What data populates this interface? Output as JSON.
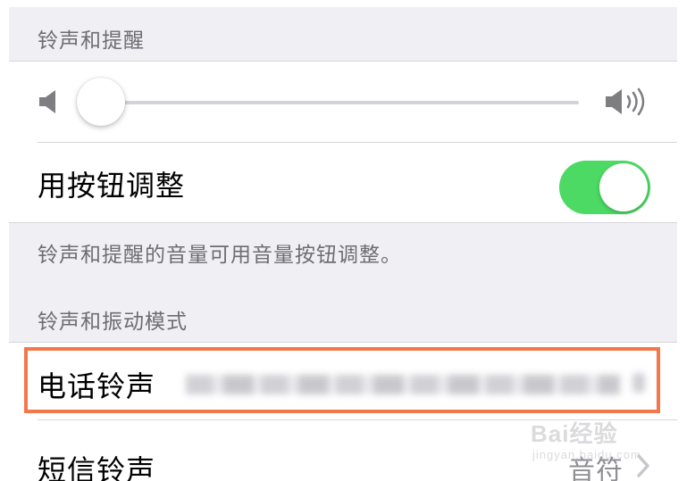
{
  "colors": {
    "background": "#efeff4",
    "section_header": "#6d6d72",
    "toggle_on": "#4cd964",
    "slider_fill": "#007aff",
    "highlight_box": "#f2784b",
    "secondary_text": "#8e8e93"
  },
  "sections": {
    "ringer": {
      "header": "铃声和提醒",
      "footer": "铃声和提醒的音量可用音量按钮调整。"
    },
    "patterns": {
      "header": "铃声和振动模式"
    }
  },
  "ringer_volume": {
    "level": 0.02,
    "low_icon": "speaker-low-icon",
    "high_icon": "speaker-high-icon"
  },
  "change_with_buttons": {
    "label": "用按钮调整",
    "state": "on"
  },
  "ringtone": {
    "label": "电话铃声",
    "value_obscured": true
  },
  "text_tone": {
    "label": "短信铃声",
    "value": "音符",
    "chevron_icon": "chevron-right-icon"
  },
  "watermark": {
    "logo": "Bai经验",
    "sub": "jingyan.baidu.com"
  }
}
